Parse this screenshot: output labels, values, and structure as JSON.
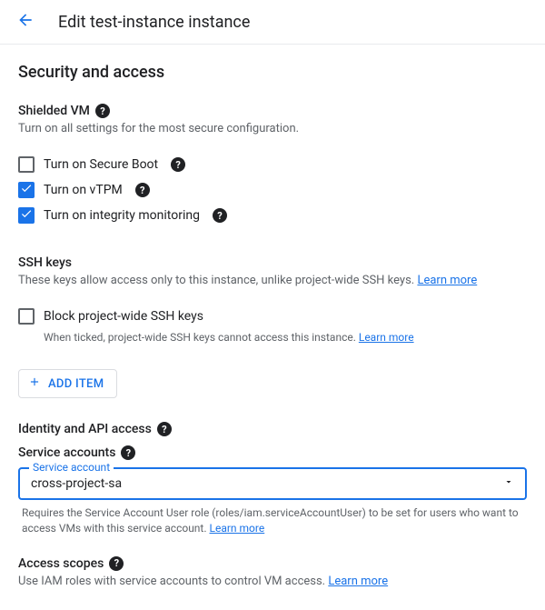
{
  "header": {
    "title": "Edit test-instance instance"
  },
  "section_title": "Security and access",
  "shielded_vm": {
    "heading": "Shielded VM",
    "desc": "Turn on all settings for the most secure configuration.",
    "options": [
      {
        "label": "Turn on Secure Boot",
        "checked": false
      },
      {
        "label": "Turn on vTPM",
        "checked": true
      },
      {
        "label": "Turn on integrity monitoring",
        "checked": true
      }
    ]
  },
  "ssh_keys": {
    "heading": "SSH keys",
    "desc_prefix": "These keys allow access only to this instance, unlike project-wide SSH keys. ",
    "learn_more": "Learn more",
    "block_label": "Block project-wide SSH keys",
    "block_sub_prefix": "When ticked, project-wide SSH keys cannot access this instance. ",
    "add_item_label": "ADD ITEM"
  },
  "identity": {
    "heading": "Identity and API access",
    "sa_heading": "Service accounts",
    "select_floating": "Service account",
    "select_value": "cross-project-sa",
    "helper_prefix": "Requires the Service Account User role (roles/iam.serviceAccountUser) to be set for users who want to access VMs with this service account. ",
    "learn_more": "Learn more"
  },
  "access_scopes": {
    "heading": "Access scopes",
    "desc_prefix": "Use IAM roles with service accounts to control VM access. ",
    "learn_more": "Learn more"
  }
}
